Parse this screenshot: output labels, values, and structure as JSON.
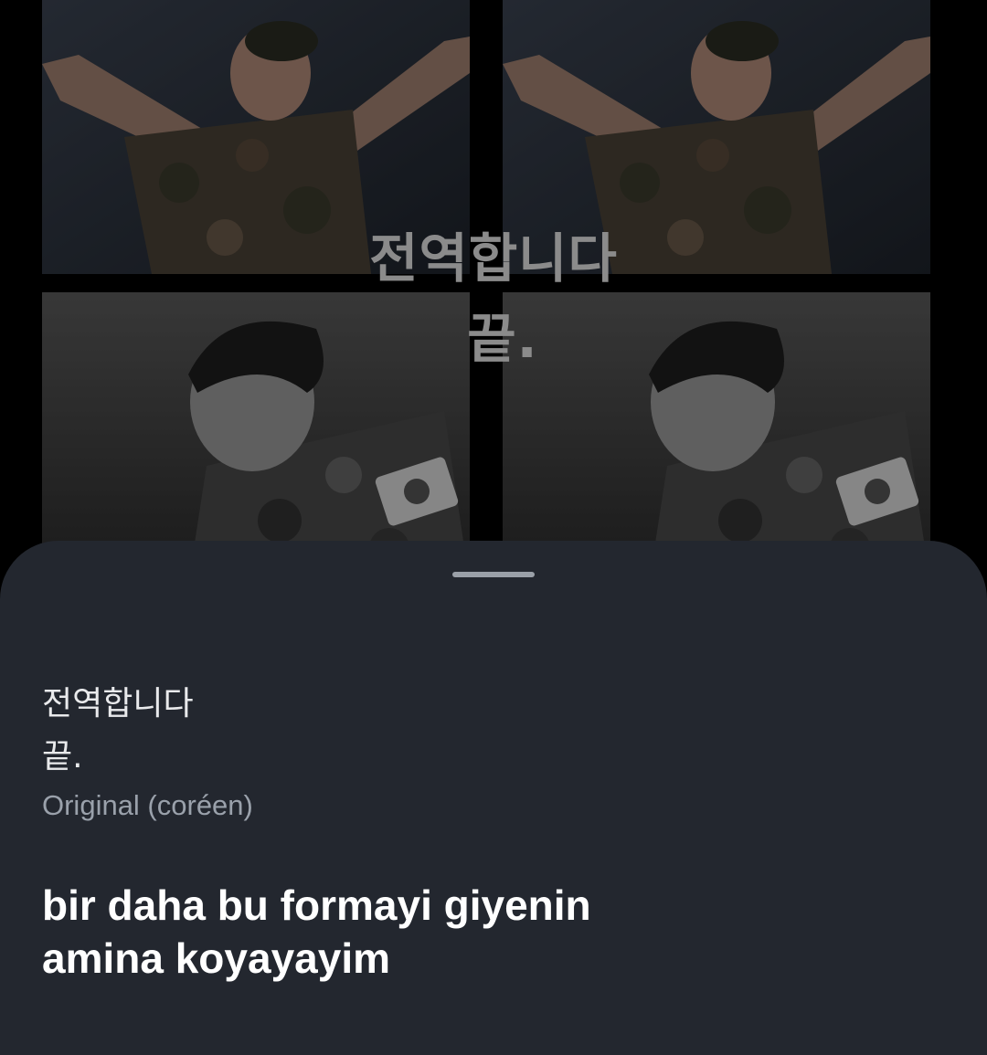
{
  "photo_overlay": {
    "line1": "전역합니다",
    "line2": "끝."
  },
  "sheet": {
    "original_lines": [
      "전역합니다",
      "끝."
    ],
    "original_language_label": "Original (coréen)",
    "translation_lines": [
      "bir daha bu formayi giyenin",
      "amina koyayayim"
    ]
  },
  "colors": {
    "sheet_background": "#23272f",
    "text_primary": "#ffffff",
    "text_secondary": "#9aa1ab",
    "handle": "#9aa0a8"
  },
  "icons": {
    "drag_handle": "drag-handle-bar"
  }
}
